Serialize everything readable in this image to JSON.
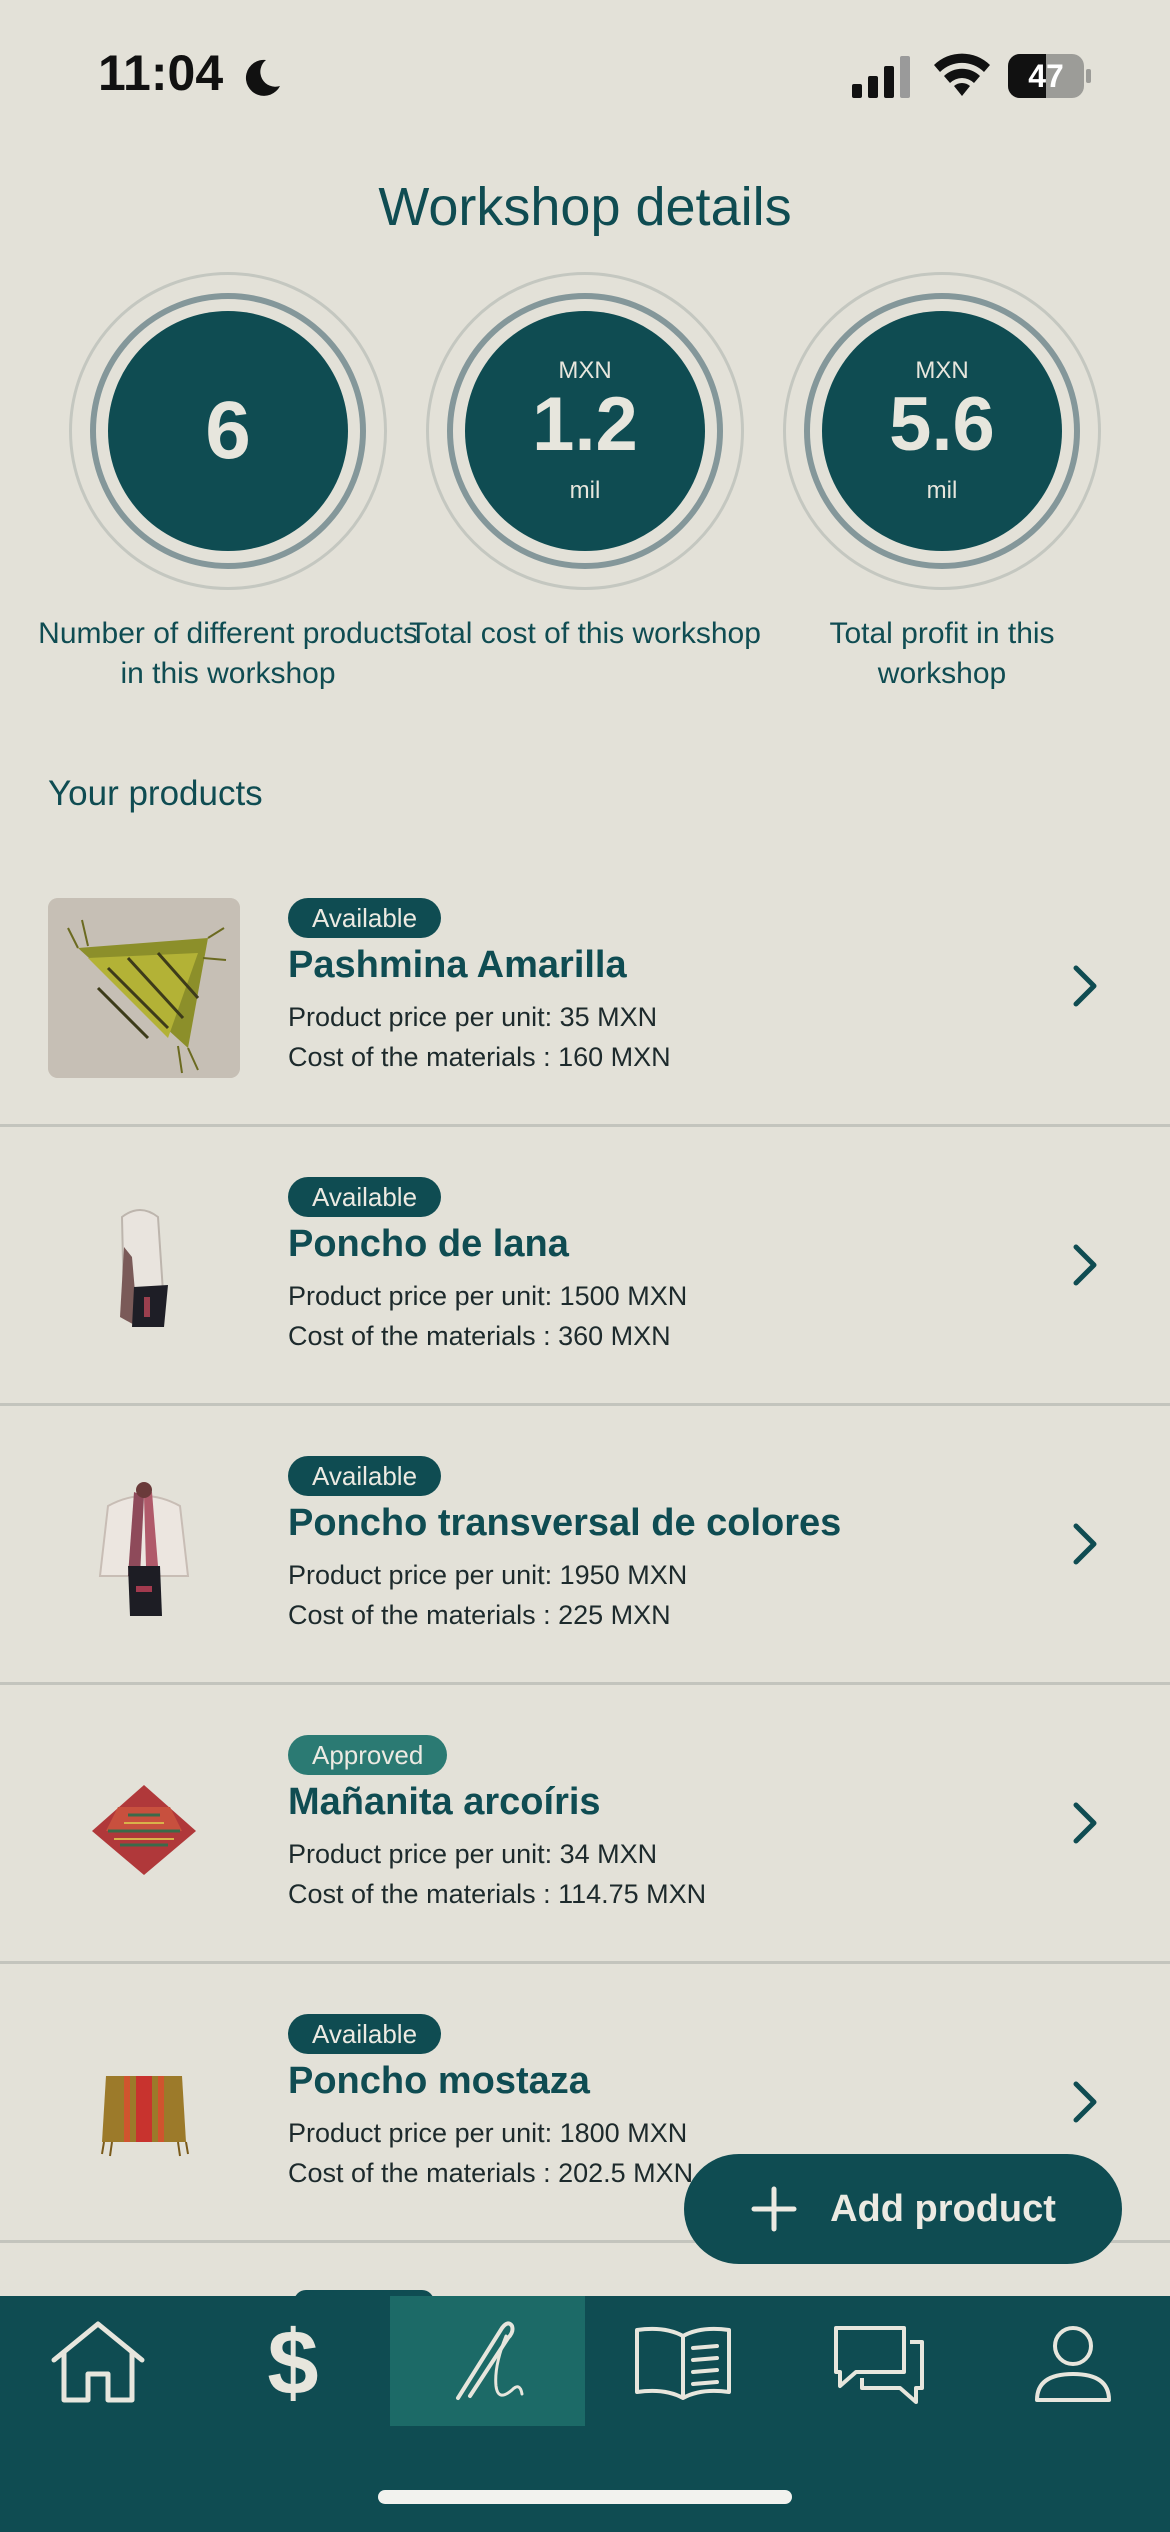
{
  "status_bar": {
    "time": "11:04",
    "battery": "47"
  },
  "page_title": "Workshop details",
  "stats": [
    {
      "unit": "",
      "value": "6",
      "suffix": "",
      "label": "Number of different products in this workshop"
    },
    {
      "unit": "MXN",
      "value": "1.2",
      "suffix": "mil",
      "label": "Total cost of this workshop"
    },
    {
      "unit": "MXN",
      "value": "5.6",
      "suffix": "mil",
      "label": "Total profit in this workshop"
    }
  ],
  "section_title": "Your products",
  "products": [
    {
      "status": "Available",
      "name": "Pashmina Amarilla",
      "price": "Product price per unit: 35 MXN",
      "cost": "Cost of the materials : 160 MXN"
    },
    {
      "status": "Available",
      "name": "Poncho de lana",
      "price": "Product price per unit: 1500 MXN",
      "cost": "Cost of the materials : 360 MXN"
    },
    {
      "status": "Available",
      "name": "Poncho transversal de colores",
      "price": "Product price per unit: 1950 MXN",
      "cost": "Cost of the materials : 225 MXN"
    },
    {
      "status": "Approved",
      "name": "Mañanita arcoíris",
      "price": "Product price per unit: 34 MXN",
      "cost": "Cost of the materials : 114.75 MXN"
    },
    {
      "status": "Available",
      "name": "Poncho mostaza",
      "price": "Product price per unit: 1800 MXN",
      "cost": "Cost of the materials : 202.5 MXN"
    }
  ],
  "add_button_label": "Add product",
  "tabs": [
    {
      "icon": "home-icon",
      "active": false
    },
    {
      "icon": "dollar-icon",
      "active": false
    },
    {
      "icon": "needle-thread-icon",
      "active": true
    },
    {
      "icon": "book-icon",
      "active": false
    },
    {
      "icon": "chat-icon",
      "active": false
    },
    {
      "icon": "profile-icon",
      "active": false
    }
  ],
  "colors": {
    "primary": "#0f4c52",
    "background": "#e3e1d8",
    "approved": "#2b7a73",
    "active_tab": "#1c6a67"
  }
}
